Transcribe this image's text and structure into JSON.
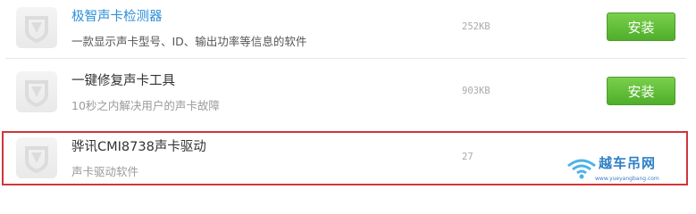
{
  "list": {
    "items": [
      {
        "name": "极智声卡检测器",
        "desc": "一款显示声卡型号、ID、输出功率等信息的软件",
        "size": "252KB",
        "button": "安装"
      },
      {
        "name": "一键修复声卡工具",
        "desc": "10秒之内解决用户的声卡故障",
        "size": "903KB",
        "button": "安装"
      },
      {
        "name": "骅讯CMI8738声卡驱动",
        "desc": "声卡驱动软件",
        "size": "27"
      }
    ]
  },
  "watermark": {
    "title": "越车吊网",
    "url": "www.yueyangbang.com"
  },
  "colors": {
    "accent_link": "#2b8fd8",
    "install_green": "#5cb836",
    "highlight_red": "#d1363a"
  },
  "icons": {
    "app": "shield-app-icon",
    "watermark": "wifi-icon"
  }
}
